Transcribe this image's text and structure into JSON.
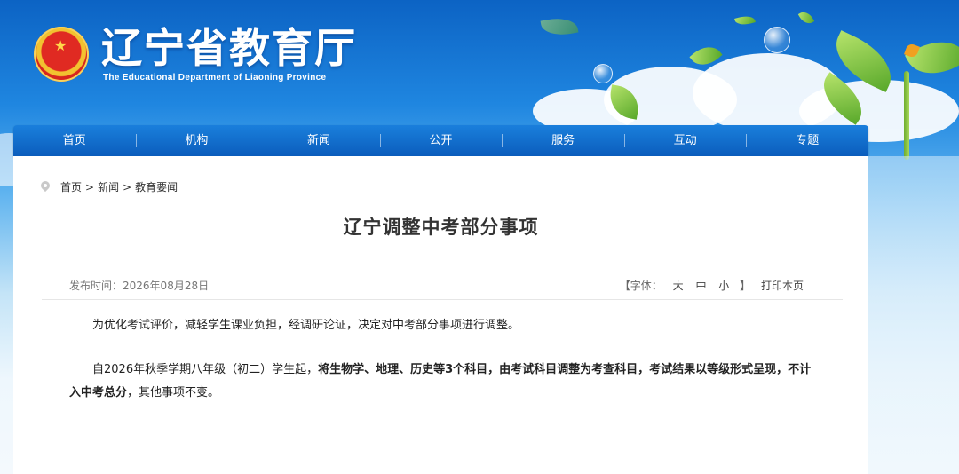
{
  "header": {
    "site_title": "辽宁省教育厅",
    "site_subtitle": "The Educational Department of Liaoning Province",
    "emblem_icon": "national-emblem-icon"
  },
  "nav": {
    "items": [
      {
        "label": "首页"
      },
      {
        "label": "机构"
      },
      {
        "label": "新闻"
      },
      {
        "label": "公开"
      },
      {
        "label": "服务"
      },
      {
        "label": "互动"
      },
      {
        "label": "专题"
      }
    ]
  },
  "breadcrumb": {
    "icon": "location-pin-icon",
    "items": [
      "首页",
      "新闻",
      "教育要闻"
    ],
    "separator": ">"
  },
  "article": {
    "title": "辽宁调整中考部分事项",
    "publish_label": "发布时间：",
    "publish_date": "2026年08月28日",
    "font_label": "【字体：",
    "font_large": "大",
    "font_medium": "中",
    "font_small": "小",
    "font_close": "】",
    "print_label": "打印本页",
    "para1": "为优化考试评价，减轻学生课业负担，经调研论证，决定对中考部分事项进行调整。",
    "para2_prefix": "自2026年秋季学期八年级（初二）学生起，",
    "para2_bold": "将生物学、地理、历史等3个科目，由考试科目调整为考查科目，考试结果以等级形式呈现，不计入中考总分",
    "para2_suffix": "，其他事项不变。"
  },
  "colors": {
    "nav_bg": "#0b5dbc",
    "banner_top": "#0c63c4",
    "text": "#333333"
  }
}
